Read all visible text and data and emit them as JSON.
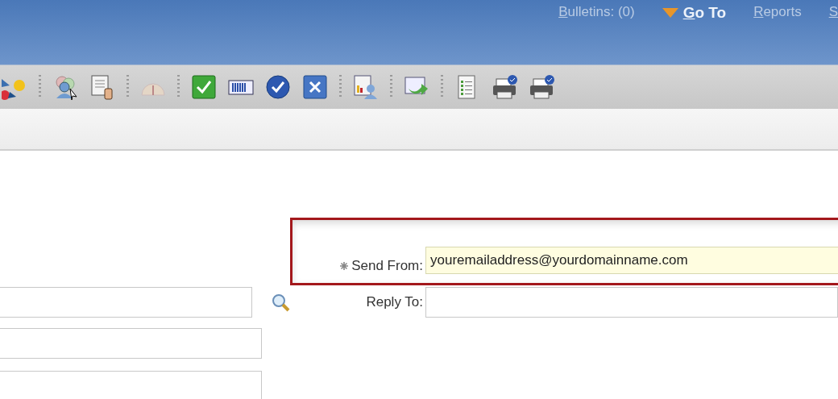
{
  "top_nav": [
    {
      "label": "Bulletins: (0)",
      "kind": "link"
    },
    {
      "label": "Go To",
      "kind": "menu"
    },
    {
      "label": "Reports",
      "kind": "link"
    },
    {
      "label": "S",
      "kind": "link"
    }
  ],
  "form": {
    "send_from": {
      "label": "Send From:",
      "required": true,
      "value": "youremailaddress@yourdomainname.com",
      "highlighted": true
    },
    "reply_to": {
      "label": "Reply To:"
    }
  }
}
